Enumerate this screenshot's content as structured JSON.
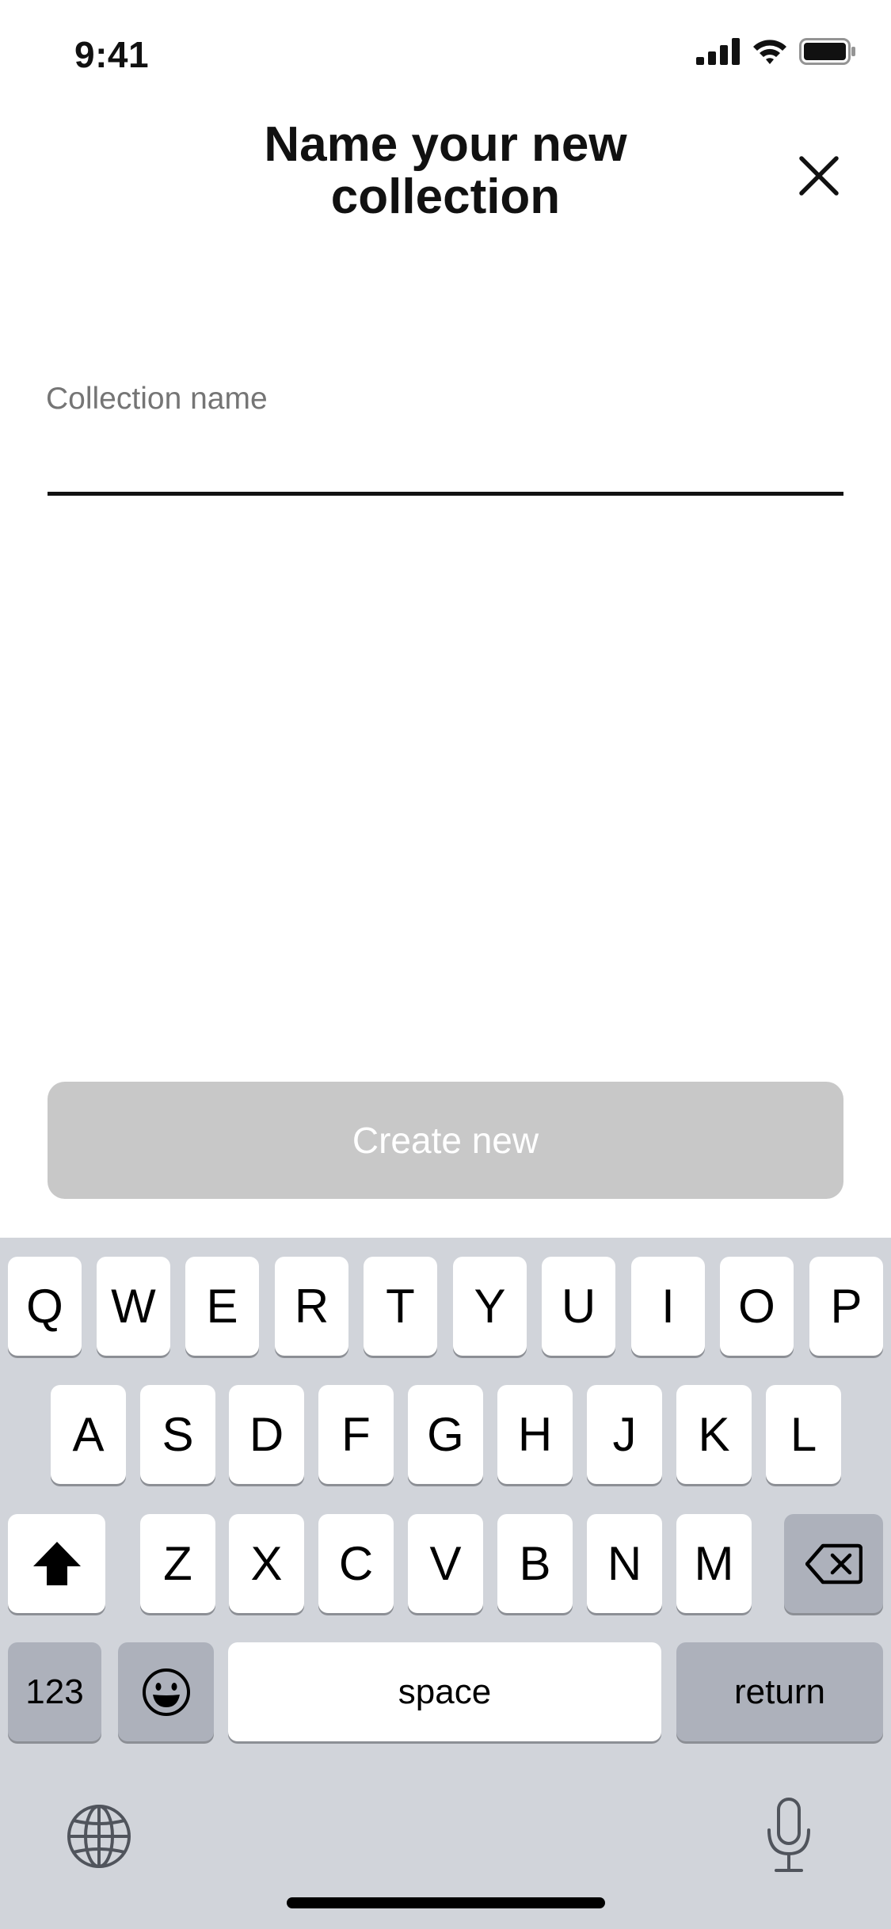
{
  "status_bar": {
    "time": "9:41",
    "icons": [
      "signal-icon",
      "wifi-icon",
      "battery-icon"
    ]
  },
  "header": {
    "title_line1": "Name your new",
    "title_line2": "collection",
    "close_icon": "close-icon"
  },
  "form": {
    "label": "Collection name",
    "value": "",
    "placeholder": ""
  },
  "primary_button": {
    "label": "Create new",
    "enabled": false,
    "color": "#c8c8c8"
  },
  "keyboard": {
    "row1": [
      "Q",
      "W",
      "E",
      "R",
      "T",
      "Y",
      "U",
      "I",
      "O",
      "P"
    ],
    "row2": [
      "A",
      "S",
      "D",
      "F",
      "G",
      "H",
      "J",
      "K",
      "L"
    ],
    "row3": [
      "Z",
      "X",
      "C",
      "V",
      "B",
      "N",
      "M"
    ],
    "numbers_label": "123",
    "space_label": "space",
    "return_label": "return",
    "icons": [
      "shift-icon",
      "backspace-icon",
      "emoji-icon",
      "globe-icon",
      "microphone-icon"
    ],
    "background_color": "#d1d4da"
  }
}
